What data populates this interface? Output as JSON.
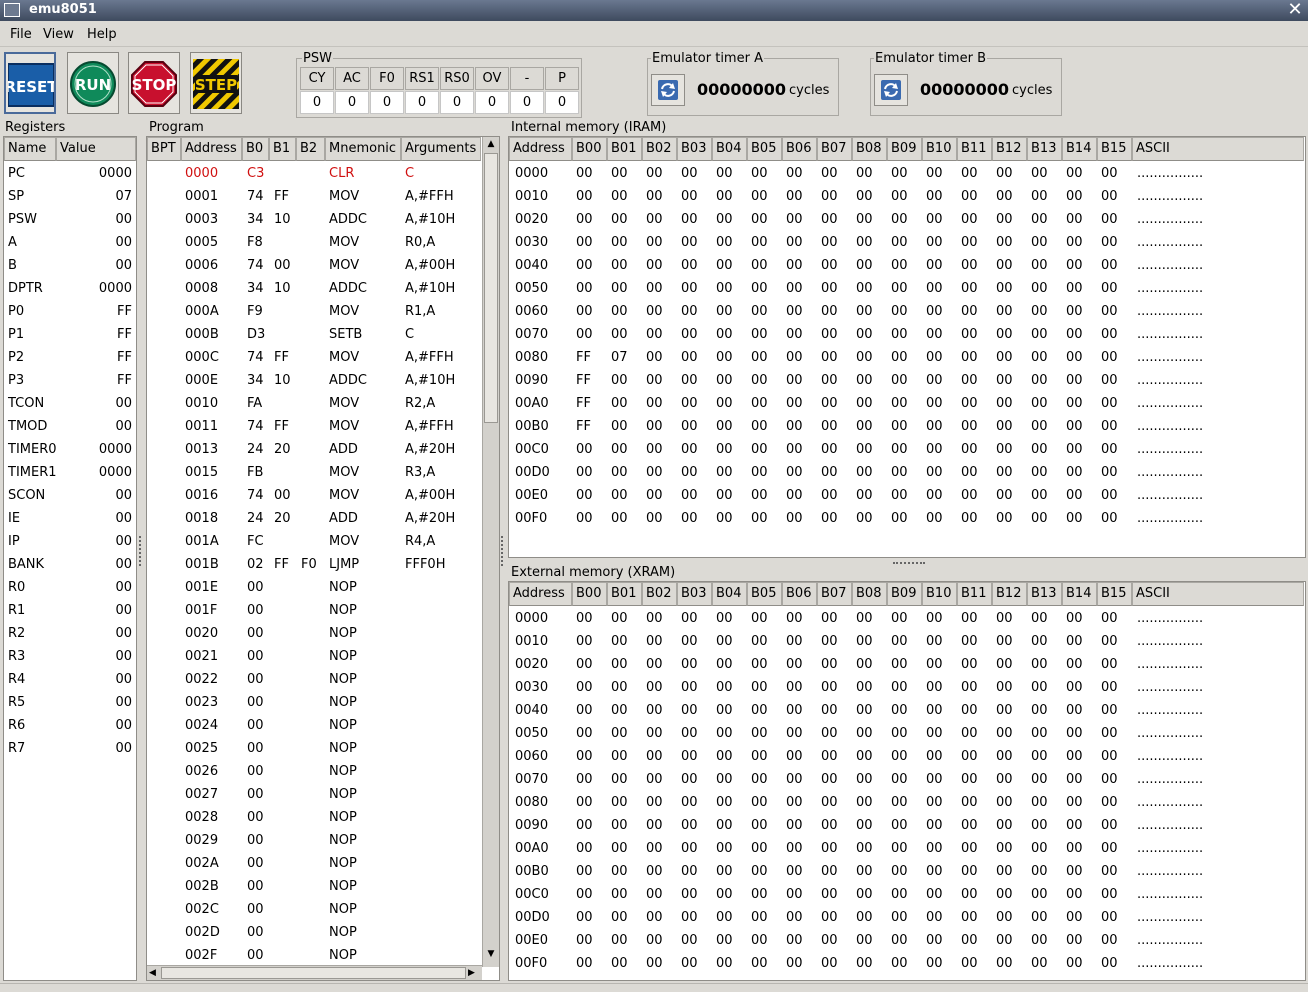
{
  "window": {
    "title": "emu8051"
  },
  "menu": [
    "File",
    "View",
    "Help"
  ],
  "toolbar": {
    "reset": "RESET",
    "run": "RUN",
    "stop": "STOP",
    "step": "STEP"
  },
  "psw": {
    "label": "PSW",
    "headers": [
      "CY",
      "AC",
      "F0",
      "RS1",
      "RS0",
      "OV",
      "-",
      "P"
    ],
    "values": [
      "0",
      "0",
      "0",
      "0",
      "0",
      "0",
      "0",
      "0"
    ]
  },
  "timerA": {
    "label": "Emulator timer A",
    "value": "00000000",
    "unit": "cycles"
  },
  "timerB": {
    "label": "Emulator timer B",
    "value": "00000000",
    "unit": "cycles"
  },
  "registers": {
    "label": "Registers",
    "headers": [
      "Name",
      "Value"
    ],
    "rows": [
      [
        "PC",
        "0000"
      ],
      [
        "SP",
        "07"
      ],
      [
        "PSW",
        "00"
      ],
      [
        "A",
        "00"
      ],
      [
        "B",
        "00"
      ],
      [
        "DPTR",
        "0000"
      ],
      [
        "P0",
        "FF"
      ],
      [
        "P1",
        "FF"
      ],
      [
        "P2",
        "FF"
      ],
      [
        "P3",
        "FF"
      ],
      [
        "TCON",
        "00"
      ],
      [
        "TMOD",
        "00"
      ],
      [
        "TIMER0",
        "0000"
      ],
      [
        "TIMER1",
        "0000"
      ],
      [
        "SCON",
        "00"
      ],
      [
        "IE",
        "00"
      ],
      [
        "IP",
        "00"
      ],
      [
        "BANK",
        "00"
      ],
      [
        "R0",
        "00"
      ],
      [
        "R1",
        "00"
      ],
      [
        "R2",
        "00"
      ],
      [
        "R3",
        "00"
      ],
      [
        "R4",
        "00"
      ],
      [
        "R5",
        "00"
      ],
      [
        "R6",
        "00"
      ],
      [
        "R7",
        "00"
      ]
    ]
  },
  "program": {
    "label": "Program",
    "headers": [
      "BPT",
      "Address",
      "B0",
      "B1",
      "B2",
      "Mnemonic",
      "Arguments"
    ],
    "rows": [
      [
        "0000",
        "C3",
        "",
        "",
        "CLR",
        "C"
      ],
      [
        "0001",
        "74",
        "FF",
        "",
        "MOV",
        "A,#FFH"
      ],
      [
        "0003",
        "34",
        "10",
        "",
        "ADDC",
        "A,#10H"
      ],
      [
        "0005",
        "F8",
        "",
        "",
        "MOV",
        "R0,A"
      ],
      [
        "0006",
        "74",
        "00",
        "",
        "MOV",
        "A,#00H"
      ],
      [
        "0008",
        "34",
        "10",
        "",
        "ADDC",
        "A,#10H"
      ],
      [
        "000A",
        "F9",
        "",
        "",
        "MOV",
        "R1,A"
      ],
      [
        "000B",
        "D3",
        "",
        "",
        "SETB",
        "C"
      ],
      [
        "000C",
        "74",
        "FF",
        "",
        "MOV",
        "A,#FFH"
      ],
      [
        "000E",
        "34",
        "10",
        "",
        "ADDC",
        "A,#10H"
      ],
      [
        "0010",
        "FA",
        "",
        "",
        "MOV",
        "R2,A"
      ],
      [
        "0011",
        "74",
        "FF",
        "",
        "MOV",
        "A,#FFH"
      ],
      [
        "0013",
        "24",
        "20",
        "",
        "ADD",
        "A,#20H"
      ],
      [
        "0015",
        "FB",
        "",
        "",
        "MOV",
        "R3,A"
      ],
      [
        "0016",
        "74",
        "00",
        "",
        "MOV",
        "A,#00H"
      ],
      [
        "0018",
        "24",
        "20",
        "",
        "ADD",
        "A,#20H"
      ],
      [
        "001A",
        "FC",
        "",
        "",
        "MOV",
        "R4,A"
      ],
      [
        "001B",
        "02",
        "FF",
        "F0",
        "LJMP",
        "FFF0H"
      ],
      [
        "001E",
        "00",
        "",
        "",
        "NOP",
        ""
      ],
      [
        "001F",
        "00",
        "",
        "",
        "NOP",
        ""
      ],
      [
        "0020",
        "00",
        "",
        "",
        "NOP",
        ""
      ],
      [
        "0021",
        "00",
        "",
        "",
        "NOP",
        ""
      ],
      [
        "0022",
        "00",
        "",
        "",
        "NOP",
        ""
      ],
      [
        "0023",
        "00",
        "",
        "",
        "NOP",
        ""
      ],
      [
        "0024",
        "00",
        "",
        "",
        "NOP",
        ""
      ],
      [
        "0025",
        "00",
        "",
        "",
        "NOP",
        ""
      ],
      [
        "0026",
        "00",
        "",
        "",
        "NOP",
        ""
      ],
      [
        "0027",
        "00",
        "",
        "",
        "NOP",
        ""
      ],
      [
        "0028",
        "00",
        "",
        "",
        "NOP",
        ""
      ],
      [
        "0029",
        "00",
        "",
        "",
        "NOP",
        ""
      ],
      [
        "002A",
        "00",
        "",
        "",
        "NOP",
        ""
      ],
      [
        "002B",
        "00",
        "",
        "",
        "NOP",
        ""
      ],
      [
        "002C",
        "00",
        "",
        "",
        "NOP",
        ""
      ],
      [
        "002D",
        "00",
        "",
        "",
        "NOP",
        ""
      ],
      [
        "002F",
        "00",
        "",
        "",
        "NOP",
        ""
      ]
    ]
  },
  "iram": {
    "label": "Internal memory (IRAM)",
    "headers": [
      "Address",
      "B00",
      "B01",
      "B02",
      "B03",
      "B04",
      "B05",
      "B06",
      "B07",
      "B08",
      "B09",
      "B10",
      "B11",
      "B12",
      "B13",
      "B14",
      "B15",
      "ASCII"
    ],
    "rows": [
      [
        "0000",
        "00",
        "00",
        "00",
        "00",
        "00",
        "00",
        "00",
        "00",
        "00",
        "00",
        "00",
        "00",
        "00",
        "00",
        "00",
        "00",
        "................"
      ],
      [
        "0010",
        "00",
        "00",
        "00",
        "00",
        "00",
        "00",
        "00",
        "00",
        "00",
        "00",
        "00",
        "00",
        "00",
        "00",
        "00",
        "00",
        "................"
      ],
      [
        "0020",
        "00",
        "00",
        "00",
        "00",
        "00",
        "00",
        "00",
        "00",
        "00",
        "00",
        "00",
        "00",
        "00",
        "00",
        "00",
        "00",
        "................"
      ],
      [
        "0030",
        "00",
        "00",
        "00",
        "00",
        "00",
        "00",
        "00",
        "00",
        "00",
        "00",
        "00",
        "00",
        "00",
        "00",
        "00",
        "00",
        "................"
      ],
      [
        "0040",
        "00",
        "00",
        "00",
        "00",
        "00",
        "00",
        "00",
        "00",
        "00",
        "00",
        "00",
        "00",
        "00",
        "00",
        "00",
        "00",
        "................"
      ],
      [
        "0050",
        "00",
        "00",
        "00",
        "00",
        "00",
        "00",
        "00",
        "00",
        "00",
        "00",
        "00",
        "00",
        "00",
        "00",
        "00",
        "00",
        "................"
      ],
      [
        "0060",
        "00",
        "00",
        "00",
        "00",
        "00",
        "00",
        "00",
        "00",
        "00",
        "00",
        "00",
        "00",
        "00",
        "00",
        "00",
        "00",
        "................"
      ],
      [
        "0070",
        "00",
        "00",
        "00",
        "00",
        "00",
        "00",
        "00",
        "00",
        "00",
        "00",
        "00",
        "00",
        "00",
        "00",
        "00",
        "00",
        "................"
      ],
      [
        "0080",
        "FF",
        "07",
        "00",
        "00",
        "00",
        "00",
        "00",
        "00",
        "00",
        "00",
        "00",
        "00",
        "00",
        "00",
        "00",
        "00",
        "................"
      ],
      [
        "0090",
        "FF",
        "00",
        "00",
        "00",
        "00",
        "00",
        "00",
        "00",
        "00",
        "00",
        "00",
        "00",
        "00",
        "00",
        "00",
        "00",
        "................"
      ],
      [
        "00A0",
        "FF",
        "00",
        "00",
        "00",
        "00",
        "00",
        "00",
        "00",
        "00",
        "00",
        "00",
        "00",
        "00",
        "00",
        "00",
        "00",
        "................"
      ],
      [
        "00B0",
        "FF",
        "00",
        "00",
        "00",
        "00",
        "00",
        "00",
        "00",
        "00",
        "00",
        "00",
        "00",
        "00",
        "00",
        "00",
        "00",
        "................"
      ],
      [
        "00C0",
        "00",
        "00",
        "00",
        "00",
        "00",
        "00",
        "00",
        "00",
        "00",
        "00",
        "00",
        "00",
        "00",
        "00",
        "00",
        "00",
        "................"
      ],
      [
        "00D0",
        "00",
        "00",
        "00",
        "00",
        "00",
        "00",
        "00",
        "00",
        "00",
        "00",
        "00",
        "00",
        "00",
        "00",
        "00",
        "00",
        "................"
      ],
      [
        "00E0",
        "00",
        "00",
        "00",
        "00",
        "00",
        "00",
        "00",
        "00",
        "00",
        "00",
        "00",
        "00",
        "00",
        "00",
        "00",
        "00",
        "................"
      ],
      [
        "00F0",
        "00",
        "00",
        "00",
        "00",
        "00",
        "00",
        "00",
        "00",
        "00",
        "00",
        "00",
        "00",
        "00",
        "00",
        "00",
        "00",
        "................"
      ]
    ]
  },
  "xram": {
    "label": "External memory (XRAM)",
    "headers": [
      "Address",
      "B00",
      "B01",
      "B02",
      "B03",
      "B04",
      "B05",
      "B06",
      "B07",
      "B08",
      "B09",
      "B10",
      "B11",
      "B12",
      "B13",
      "B14",
      "B15",
      "ASCII"
    ],
    "rows": [
      [
        "0000",
        "00",
        "00",
        "00",
        "00",
        "00",
        "00",
        "00",
        "00",
        "00",
        "00",
        "00",
        "00",
        "00",
        "00",
        "00",
        "00",
        "................"
      ],
      [
        "0010",
        "00",
        "00",
        "00",
        "00",
        "00",
        "00",
        "00",
        "00",
        "00",
        "00",
        "00",
        "00",
        "00",
        "00",
        "00",
        "00",
        "................"
      ],
      [
        "0020",
        "00",
        "00",
        "00",
        "00",
        "00",
        "00",
        "00",
        "00",
        "00",
        "00",
        "00",
        "00",
        "00",
        "00",
        "00",
        "00",
        "................"
      ],
      [
        "0030",
        "00",
        "00",
        "00",
        "00",
        "00",
        "00",
        "00",
        "00",
        "00",
        "00",
        "00",
        "00",
        "00",
        "00",
        "00",
        "00",
        "................"
      ],
      [
        "0040",
        "00",
        "00",
        "00",
        "00",
        "00",
        "00",
        "00",
        "00",
        "00",
        "00",
        "00",
        "00",
        "00",
        "00",
        "00",
        "00",
        "................"
      ],
      [
        "0050",
        "00",
        "00",
        "00",
        "00",
        "00",
        "00",
        "00",
        "00",
        "00",
        "00",
        "00",
        "00",
        "00",
        "00",
        "00",
        "00",
        "................"
      ],
      [
        "0060",
        "00",
        "00",
        "00",
        "00",
        "00",
        "00",
        "00",
        "00",
        "00",
        "00",
        "00",
        "00",
        "00",
        "00",
        "00",
        "00",
        "................"
      ],
      [
        "0070",
        "00",
        "00",
        "00",
        "00",
        "00",
        "00",
        "00",
        "00",
        "00",
        "00",
        "00",
        "00",
        "00",
        "00",
        "00",
        "00",
        "................"
      ],
      [
        "0080",
        "00",
        "00",
        "00",
        "00",
        "00",
        "00",
        "00",
        "00",
        "00",
        "00",
        "00",
        "00",
        "00",
        "00",
        "00",
        "00",
        "................"
      ],
      [
        "0090",
        "00",
        "00",
        "00",
        "00",
        "00",
        "00",
        "00",
        "00",
        "00",
        "00",
        "00",
        "00",
        "00",
        "00",
        "00",
        "00",
        "................"
      ],
      [
        "00A0",
        "00",
        "00",
        "00",
        "00",
        "00",
        "00",
        "00",
        "00",
        "00",
        "00",
        "00",
        "00",
        "00",
        "00",
        "00",
        "00",
        "................"
      ],
      [
        "00B0",
        "00",
        "00",
        "00",
        "00",
        "00",
        "00",
        "00",
        "00",
        "00",
        "00",
        "00",
        "00",
        "00",
        "00",
        "00",
        "00",
        "................"
      ],
      [
        "00C0",
        "00",
        "00",
        "00",
        "00",
        "00",
        "00",
        "00",
        "00",
        "00",
        "00",
        "00",
        "00",
        "00",
        "00",
        "00",
        "00",
        "................"
      ],
      [
        "00D0",
        "00",
        "00",
        "00",
        "00",
        "00",
        "00",
        "00",
        "00",
        "00",
        "00",
        "00",
        "00",
        "00",
        "00",
        "00",
        "00",
        "................"
      ],
      [
        "00E0",
        "00",
        "00",
        "00",
        "00",
        "00",
        "00",
        "00",
        "00",
        "00",
        "00",
        "00",
        "00",
        "00",
        "00",
        "00",
        "00",
        "................"
      ],
      [
        "00F0",
        "00",
        "00",
        "00",
        "00",
        "00",
        "00",
        "00",
        "00",
        "00",
        "00",
        "00",
        "00",
        "00",
        "00",
        "00",
        "00",
        "................"
      ]
    ]
  },
  "colors": {
    "current_line": "#d01010",
    "reset_button": "#1a5ea8",
    "run_button": "#0f8a5a",
    "stop_button": "#c8102e",
    "step_stripes": "#f0c800"
  }
}
